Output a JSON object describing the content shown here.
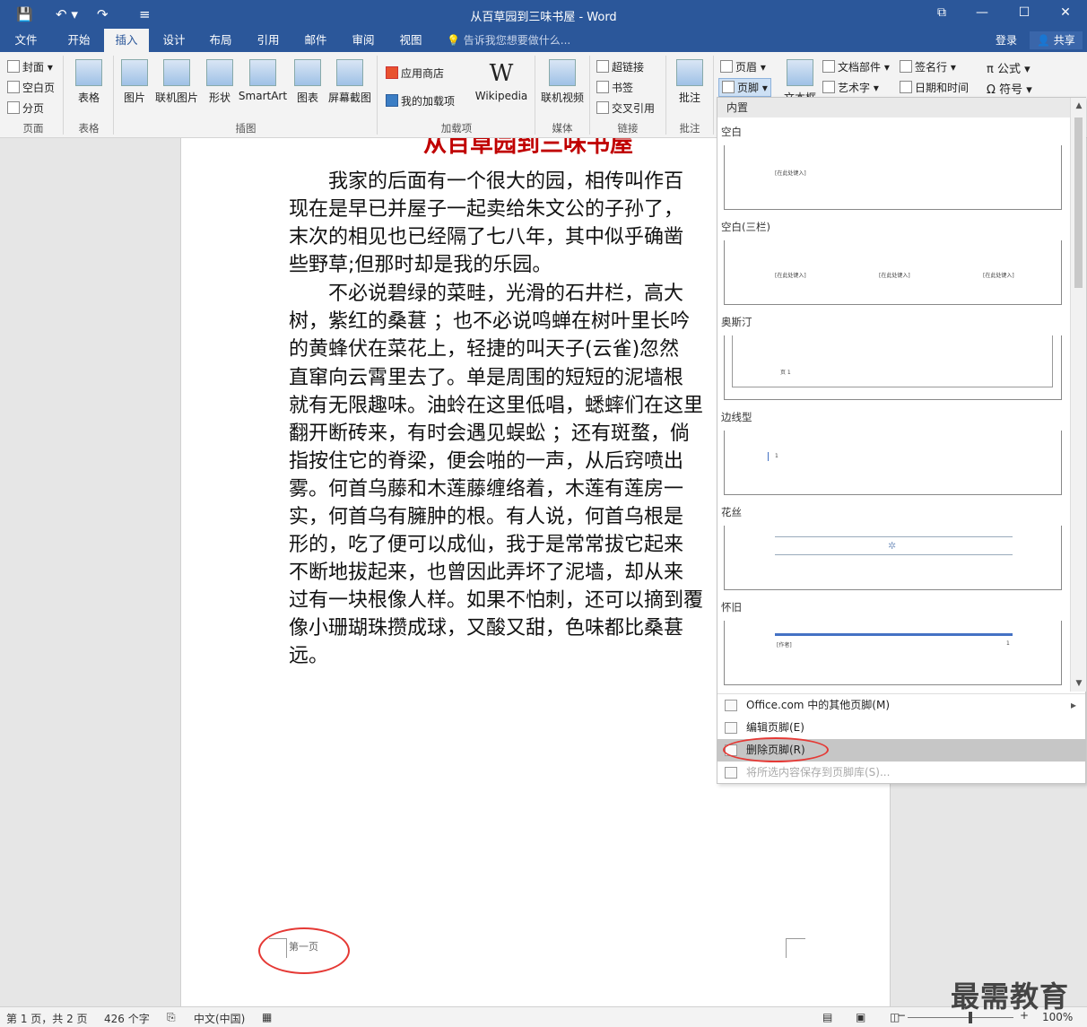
{
  "titlebar": {
    "title": "从百草园到三味书屋 - Word",
    "save": "💾",
    "undo": "↶ ▾",
    "redo": "↷",
    "customize": "≡",
    "ribbon_display": "⧉",
    "minimize": "—",
    "restore": "☐",
    "close": "✕"
  },
  "tabs": [
    "文件",
    "开始",
    "插入",
    "设计",
    "布局",
    "引用",
    "邮件",
    "审阅",
    "视图"
  ],
  "tell_me": "💡 告诉我您想要做什么...",
  "login": "登录",
  "share": "👤 共享",
  "ribbon": {
    "pages": {
      "cover": "封面 ▾",
      "blank": "空白页",
      "break": "分页",
      "label": "页面"
    },
    "table": {
      "label": "表格",
      "btn": "表格"
    },
    "illustrations": {
      "picture": "图片",
      "online_picture": "联机图片",
      "shapes": "形状",
      "smartart": "SmartArt",
      "chart": "图表",
      "screenshot": "屏幕截图",
      "label": "插图"
    },
    "addins": {
      "store": "应用商店",
      "my": "我的加载项",
      "wikipedia": "Wikipedia",
      "label": "加载项"
    },
    "media": {
      "video": "联机视频",
      "label": "媒体"
    },
    "links": {
      "hyperlink": "超链接",
      "bookmark": "书签",
      "crossref": "交叉引用",
      "label": "链接"
    },
    "comments": {
      "comment": "批注",
      "label": "批注"
    },
    "headerfooter": {
      "header": "页眉 ▾",
      "footer": "页脚 ▾"
    },
    "text": {
      "textbox": "文本框",
      "parts": "文档部件 ▾",
      "wordart": "艺术字 ▾",
      "signature": "签名行 ▾",
      "datetime": "日期和时间"
    },
    "symbols": {
      "equation": "π 公式 ▾",
      "symbol": "Ω 符号 ▾"
    }
  },
  "document": {
    "title": "从百草园到三味书屋",
    "lines": [
      "　　我家的后面有一个很大的园，相传叫作百",
      "现在是早已并屋子一起卖给朱文公的子孙了，",
      "末次的相见也已经隔了七八年，其中似乎确凿",
      "些野草;但那时却是我的乐园。",
      "　　不必说碧绿的菜畦，光滑的石井栏，高大",
      "树，紫红的桑葚 ；也不必说鸣蝉在树叶里长吟",
      "的黄蜂伏在菜花上，轻捷的叫天子(云雀)忽然",
      "直窜向云霄里去了。单是周围的短短的泥墙根",
      "就有无限趣味。油蛉在这里低唱，蟋蟀们在这里",
      "翻开断砖来，有时会遇见蜈蚣 ；还有斑蝥，倘",
      "指按住它的脊梁，便会啪的一声，从后窍喷出",
      "雾。何首乌藤和木莲藤缠络着，木莲有莲房一",
      "实，何首乌有臃肿的根。有人说，何首乌根是",
      "形的，吃了便可以成仙，我于是常常拔它起来",
      "不断地拔起来，也曾因此弄坏了泥墙，却从来",
      "过有一块根像人样。如果不怕刺，还可以摘到覆",
      "像小珊瑚珠攒成球，又酸又甜，色味都比桑葚",
      "远。"
    ],
    "footer_text": "第一页"
  },
  "dropdown": {
    "header": "内置",
    "sections": [
      {
        "name": "空白",
        "placeholders": [
          "[在此处键入]"
        ]
      },
      {
        "name": "空白(三栏)",
        "placeholders": [
          "[在此处键入]",
          "[在此处键入]",
          "[在此处键入]"
        ]
      },
      {
        "name": "奥斯汀",
        "placeholders": [
          "页 1"
        ]
      },
      {
        "name": "边线型",
        "placeholders": [
          "1"
        ]
      },
      {
        "name": "花丝",
        "placeholders": []
      },
      {
        "name": "怀旧",
        "placeholders": [
          "[作者]",
          "1"
        ]
      }
    ],
    "menu": [
      {
        "label": "Office.com 中的其他页脚(M)",
        "arrow": "▸"
      },
      {
        "label": "编辑页脚(E)"
      },
      {
        "label": "删除页脚(R)"
      },
      {
        "label": "将所选内容保存到页脚库(S)..."
      }
    ]
  },
  "status": {
    "page": "第 1 页，共 2 页",
    "words": "426 个字",
    "lang": "中文(中国)",
    "zoom": "100%"
  },
  "watermark": "最需教育",
  "colors": {
    "accent": "#2b579a",
    "title_red": "#c00000",
    "annotation": "#e53935"
  }
}
